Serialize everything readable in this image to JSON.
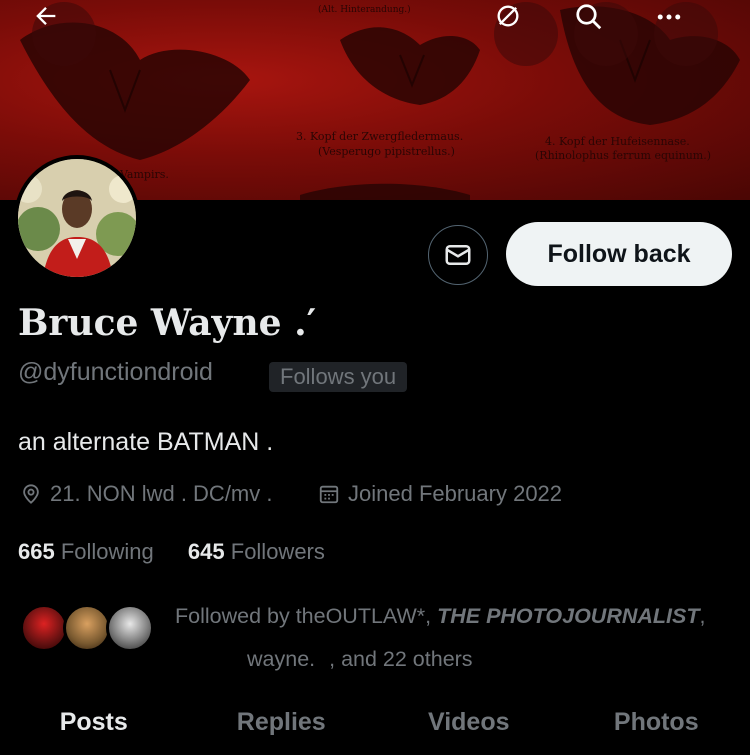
{
  "banner": {
    "captions": [
      "3. Kopf der Zwergfledermaus.",
      "(Vesperugo pipistrellus.)",
      "4. Kopf der Hufeisennase.",
      "(Rhinolophus ferrum equinum.)",
      "Vampirs.",
      "(Alt. Hinterandung.)"
    ]
  },
  "nav": {
    "back_icon": "arrow-left-icon",
    "grok_icon": "grok-icon",
    "search_icon": "search-icon",
    "more_icon": "more-icon"
  },
  "profile": {
    "name": "Bruce Wayne .′",
    "handle": "@dyfunctiondroid",
    "follows_you": "Follows you",
    "bio": "an alternate BATMAN .",
    "location": "21. NON lwd . DC/mv .",
    "joined": "Joined February 2022",
    "following_count": "665",
    "following_label": "Following",
    "followers_count": "645",
    "followers_label": "Followers"
  },
  "actions": {
    "follow_back": "Follow back"
  },
  "followed_by": {
    "prefix": "Followed by theOUTLAW*,",
    "second": "THE PHOTOJOURNALIST",
    "third": "wayne.",
    "suffix": ", and 22 others"
  },
  "tabs": [
    "Posts",
    "Replies",
    "Videos",
    "Photos"
  ],
  "colors": {
    "background": "#000000",
    "text": "#e7e9ea",
    "secondary": "#71767b",
    "button": "#eff3f4",
    "banner": "#a8150f"
  }
}
